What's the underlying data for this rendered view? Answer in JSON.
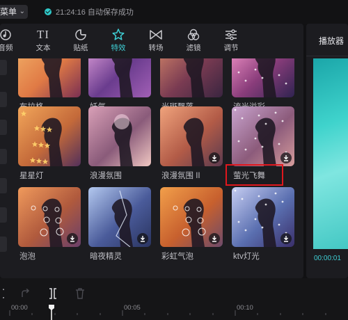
{
  "topbar": {
    "menu_label": "菜单",
    "save_status": "21:24:16 自动保存成功"
  },
  "tabs": [
    {
      "label": "音频",
      "icon": "audio-icon",
      "active": false
    },
    {
      "label": "文本",
      "icon": "text-icon",
      "active": false
    },
    {
      "label": "贴纸",
      "icon": "sticker-icon",
      "active": false
    },
    {
      "label": "特效",
      "icon": "effects-icon",
      "active": true
    },
    {
      "label": "转场",
      "icon": "transition-icon",
      "active": false
    },
    {
      "label": "滤镜",
      "icon": "filter-icon",
      "active": false
    },
    {
      "label": "调节",
      "icon": "adjust-icon",
      "active": false
    }
  ],
  "effects": [
    {
      "label": "布拉格",
      "downloaded": true
    },
    {
      "label": "妖气",
      "downloaded": true
    },
    {
      "label": "光斑飘落",
      "downloaded": true
    },
    {
      "label": "流光溢彩",
      "downloaded": true
    },
    {
      "label": "星星灯",
      "downloaded": true
    },
    {
      "label": "浪漫氛围",
      "downloaded": true
    },
    {
      "label": "浪漫氛围 II",
      "downloaded": false
    },
    {
      "label": "萤光飞舞",
      "downloaded": false
    },
    {
      "label": "泡泡",
      "downloaded": false
    },
    {
      "label": "暗夜精灵",
      "downloaded": false
    },
    {
      "label": "彩虹气泡",
      "downloaded": false
    },
    {
      "label": "ktv灯光",
      "downloaded": false
    }
  ],
  "highlighted_effect": "萤光飞舞",
  "highlight_color": "#e0171d",
  "accent_color": "#3fd0d6",
  "player": {
    "title": "播放器",
    "current_time": "00:00:01"
  },
  "timeline": {
    "ruler_labels": [
      "00:00",
      "00:05",
      "00:10"
    ]
  }
}
